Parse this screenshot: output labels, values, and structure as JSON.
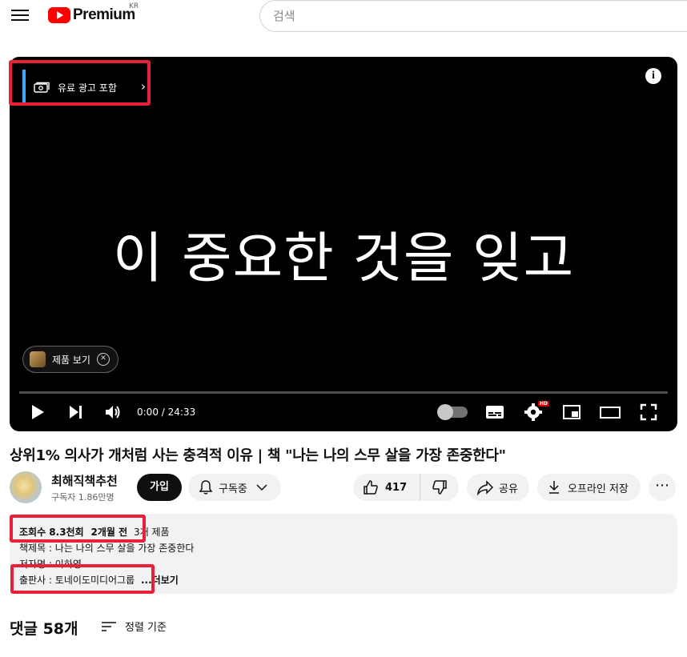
{
  "header": {
    "logo_text": "Premium",
    "country": "KR",
    "search_placeholder": "검색"
  },
  "player": {
    "ad_label": "유료 광고 포함",
    "subtitle": "이 중요한 것을 잊고",
    "product_chip": "제품 보기",
    "time": "0:00 / 24:33",
    "hd_badge": "HD",
    "progress_fraction": 0.0
  },
  "video": {
    "title": "상위1% 의사가 개처럼 사는 충격적 이유 | 책 \"나는 나의 스무 살을 가장 존중한다\""
  },
  "channel": {
    "name": "최해직책추천",
    "subscribers": "구독자 1.86만명",
    "join_label": "가입",
    "subscribed_label": "구독중"
  },
  "actions": {
    "like_count": "417",
    "share_label": "공유",
    "download_label": "오프라인 저장"
  },
  "description": {
    "views": "조회수 8.3천회",
    "date": "2개월 전",
    "line1_rest": "3개 제품",
    "line2": "책제목 : 나는 나의 스무 살을 가장 존중한다",
    "line3": "저자명 : 이하영",
    "line4": "출판사 : 토네이도미디어그룹",
    "more": "...더보기"
  },
  "comments": {
    "count_label": "댓글 58개",
    "sort_label": "정렬 기준"
  },
  "colors": {
    "brand_red": "#ff0000",
    "highlight_red": "#e8213a",
    "ad_accent": "#3ea6ff"
  }
}
